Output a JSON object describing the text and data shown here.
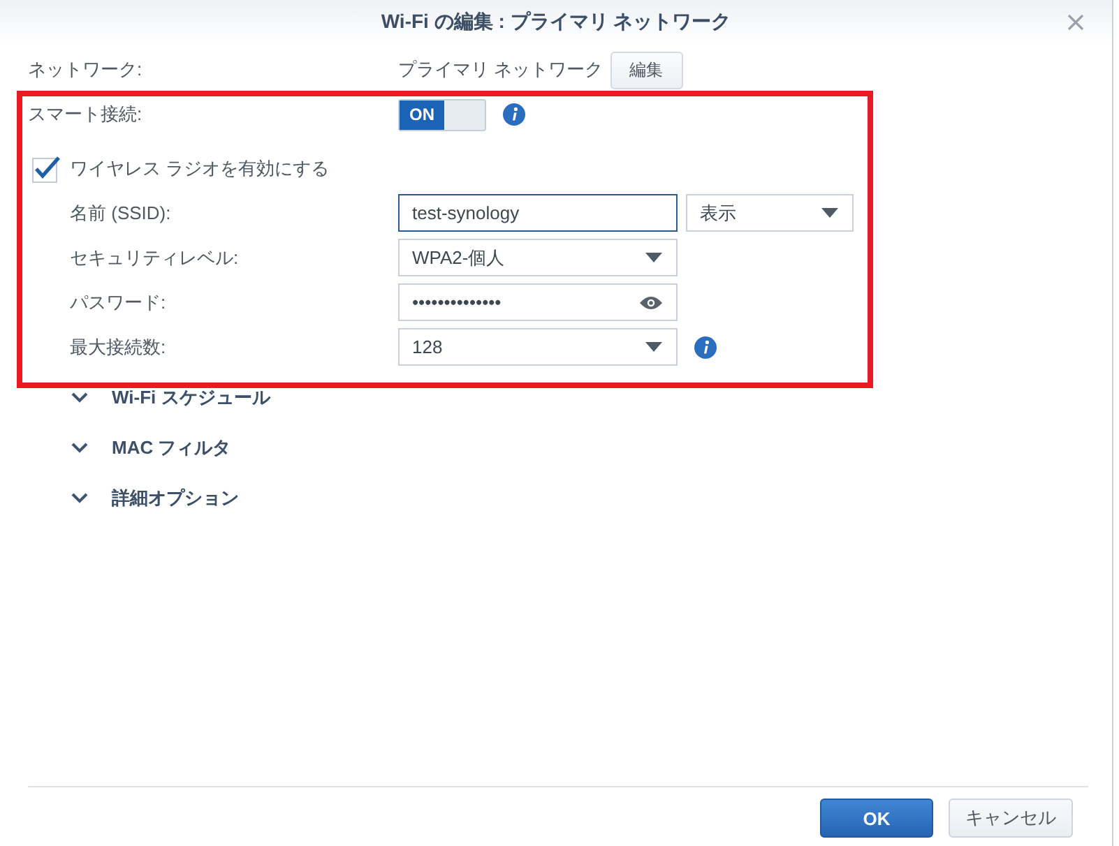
{
  "window": {
    "title": "Wi-Fi の編集 : プライマリ ネットワーク"
  },
  "network": {
    "label": "ネットワーク:",
    "value": "プライマリ ネットワーク",
    "button": "編集"
  },
  "smart_connect": {
    "label": "スマート接続:",
    "info": true,
    "toggle": {
      "on": true,
      "text": "ON"
    }
  },
  "wireless_radio": {
    "label": "ワイヤレス ラジオを有効にする",
    "checked": true
  },
  "fields": [
    {
      "kind": "text",
      "label": "名前 (SSID):",
      "value": "test-synology",
      "focused": true,
      "info": false,
      "side_dropdown": "表示"
    },
    {
      "kind": "dropdown",
      "label": "セキュリティレベル:",
      "value": "WPA2-個人",
      "focused": false,
      "info": false
    },
    {
      "kind": "password",
      "label": "パスワード:",
      "value": "••••••••••••••",
      "focused": false,
      "info": false
    },
    {
      "kind": "dropdown",
      "label": "最大接続数:",
      "value": "128",
      "focused": false,
      "info": true
    }
  ],
  "sections": [
    {
      "label": "Wi-Fi スケジュール",
      "expanded": false
    },
    {
      "label": "MAC フィルタ",
      "expanded": false
    },
    {
      "label": "詳細オプション",
      "expanded": false
    }
  ],
  "buttons": [
    {
      "label": "OK",
      "kind": "primary"
    },
    {
      "label": "キャンセル",
      "kind": "secondary"
    }
  ]
}
